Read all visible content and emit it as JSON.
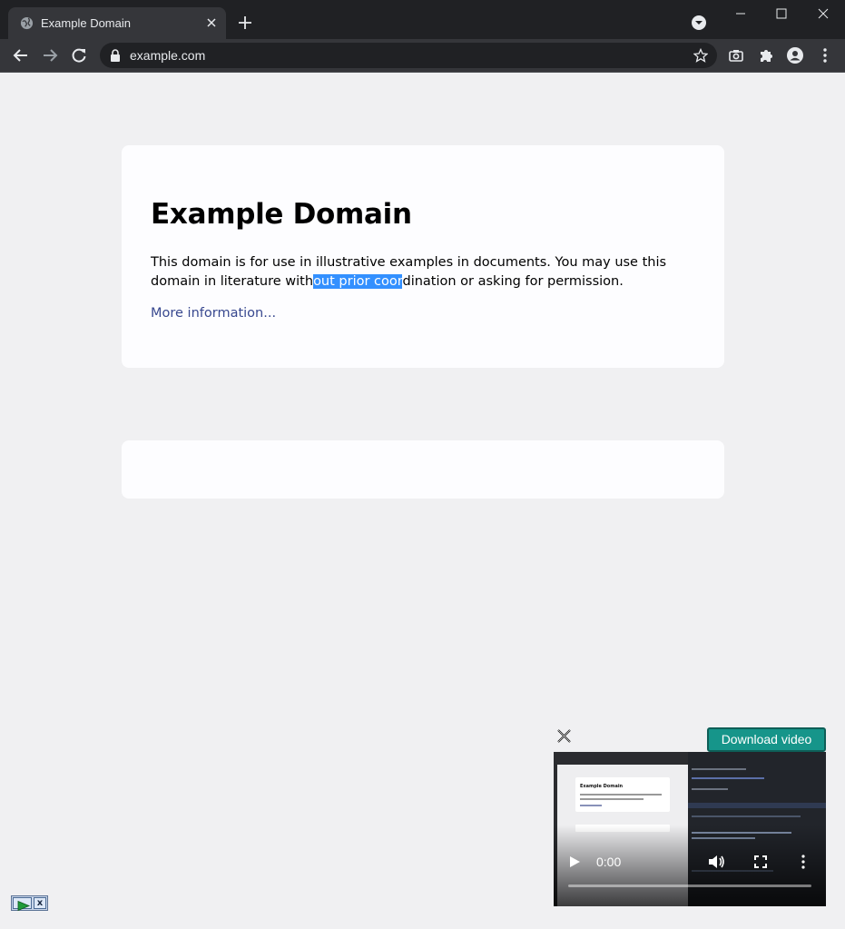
{
  "browser": {
    "tab_title": "Example Domain",
    "url": "example.com"
  },
  "page": {
    "heading": "Example Domain",
    "para_before_selection": "This domain is for use in illustrative examples in documents. You may use this domain in literature with",
    "para_selected": "out prior coor",
    "para_after_selection": "dination or asking for permission.",
    "more_link": "More information..."
  },
  "video_overlay": {
    "download_label": "Download video",
    "time": "0:00",
    "progress": 0,
    "thumb_title": "Example Domain"
  },
  "mini_widget": {
    "close_label": "x"
  },
  "colors": {
    "chrome_dark": "#202124",
    "chrome_tab": "#35363a",
    "page_bg": "#f0f0f2",
    "link": "#38488f",
    "selection": "#3390ff",
    "download_button": "#16958a"
  }
}
